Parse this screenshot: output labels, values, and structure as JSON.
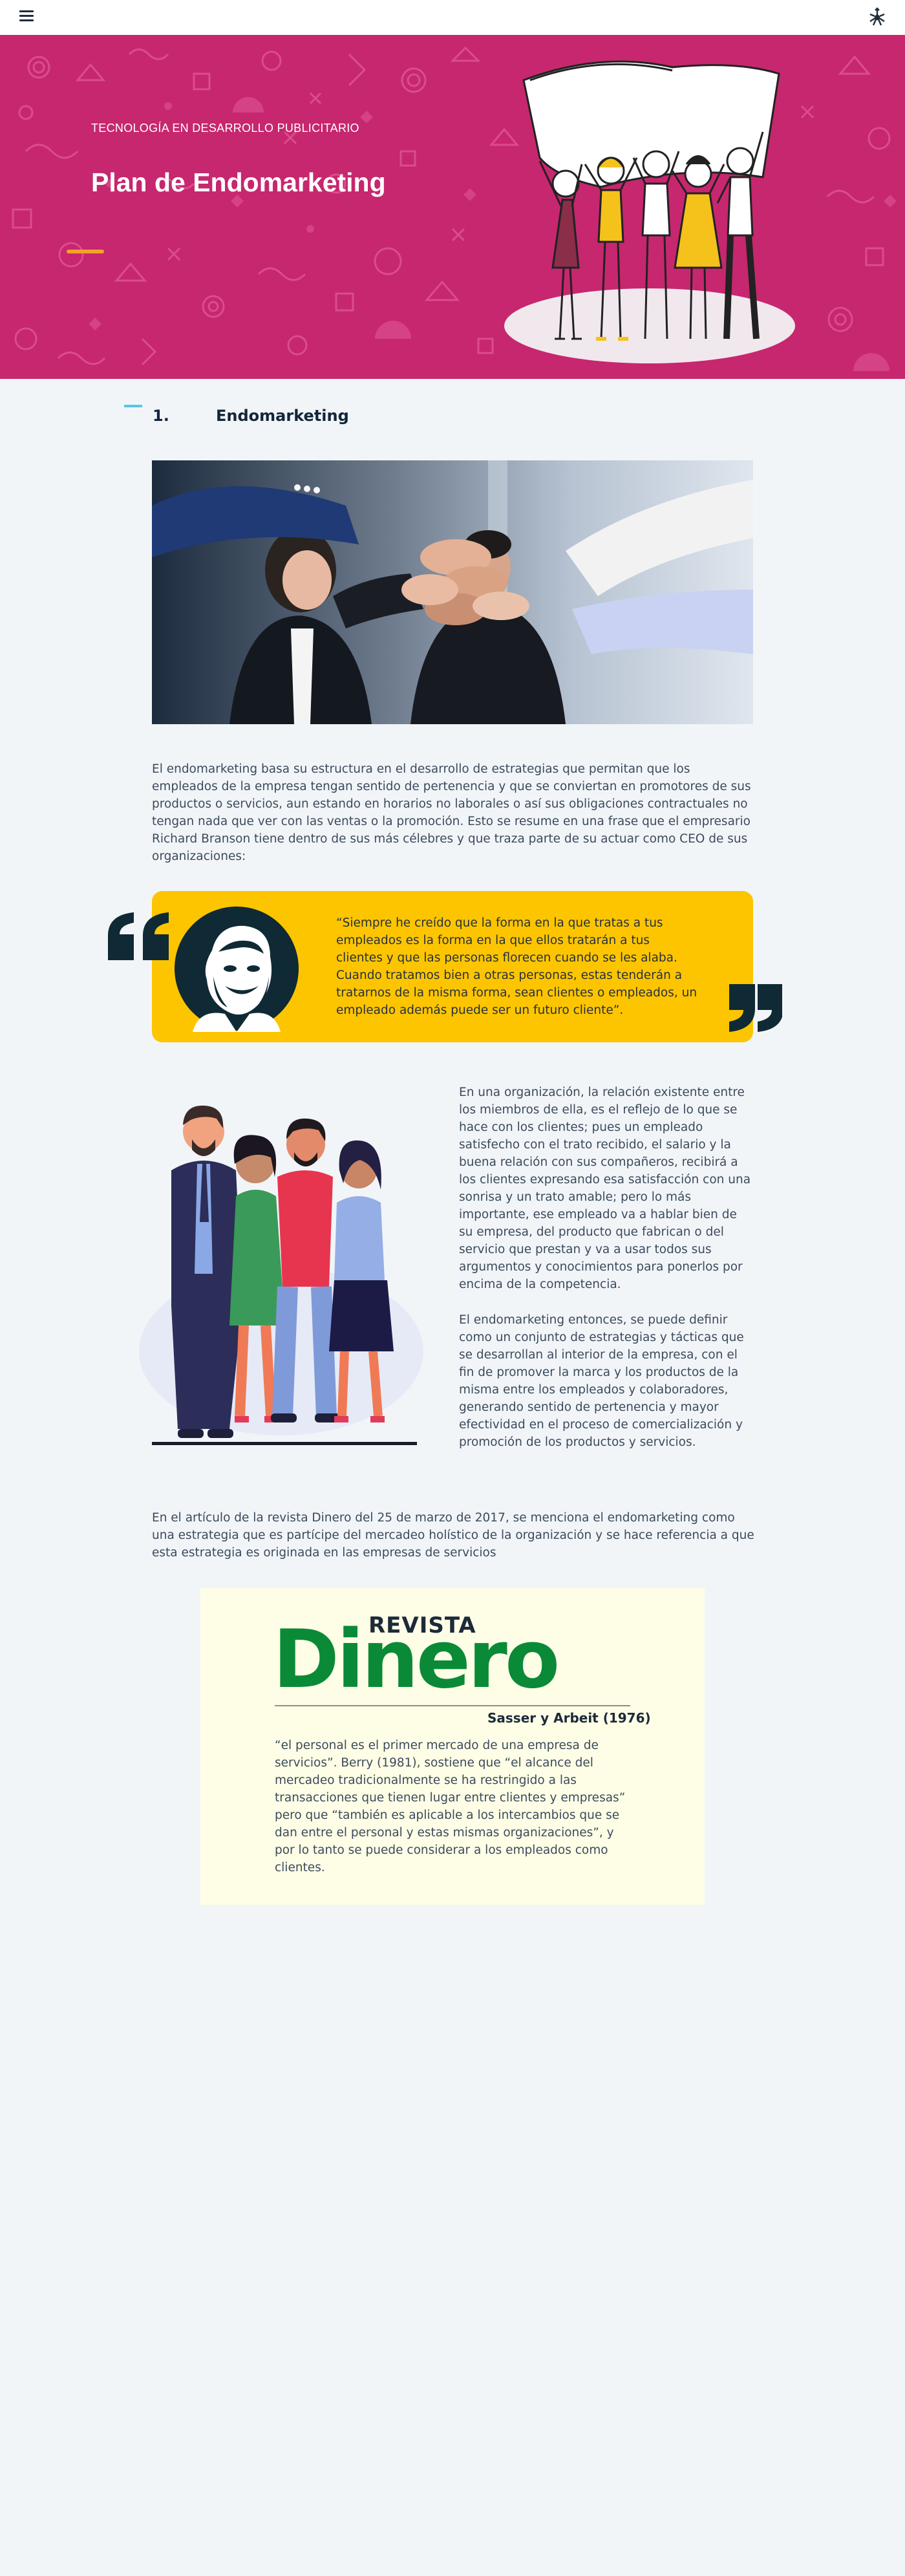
{
  "topbar": {
    "menu_icon": "hamburger-menu-icon",
    "logo_icon": "sena-logo-icon"
  },
  "hero": {
    "kicker": "TECNOLOGÍA EN DESARROLLO PUBLICITARIO",
    "title": "Plan de Endomarketing",
    "colors": {
      "background": "#c7276f",
      "accent": "#f2a12a"
    }
  },
  "section": {
    "number": "1.",
    "title": "Endomarketing"
  },
  "content": {
    "intro": "El endomarketing basa su estructura en el desarrollo de estrategias que permitan que los empleados de la empresa tengan sentido de pertenencia y que se conviertan en promotores de sus productos o servicios, aun estando en horarios no laborales o así sus obligaciones contractuales no tengan nada que ver con las ventas o la promoción. Esto se resume en una frase que el empresario Richard Branson tiene dentro de sus más célebres y que traza parte de su actuar como CEO de sus organizaciones:",
    "quote": "“Siempre he creído que la forma en la que tratas a tus empleados es la forma en la que ellos tratarán a tus clientes y que las personas florecen cuando se les alaba. Cuando tratamos bien a otras personas, estas tenderán a tratarnos de la misma forma, sean clientes o empleados, un empleado además puede ser un futuro cliente”.",
    "para2": "En una organización, la relación existente entre los miembros de ella, es el reflejo de lo que se hace con los clientes; pues un empleado satisfecho con el trato recibido, el salario y la buena relación con sus compañeros, recibirá a los clientes expresando esa satisfacción con una sonrisa y un trato amable; pero lo más importante, ese empleado va a hablar bien de su empresa, del producto que fabrican o del servicio que prestan y va a usar todos sus argumentos y conocimientos para ponerlos por encima de la competencia.",
    "para3": "El endomarketing entonces, se puede definir como un conjunto de estrategias y tácticas que se desarrollan al interior de la empresa, con el fin de promover la marca y los productos de la misma entre los empleados y colaboradores, generando sentido de pertenencia y mayor efectividad en el proceso de comercialización y promoción de los productos y servicios.",
    "para4": "En el artículo de la revista Dinero del 25 de marzo de 2017, se menciona el endomarketing como una estrategia que es partícipe del mercadeo holístico de la organización y se hace referencia a que esta estrategia es originada en las empresas de servicios"
  },
  "dinero": {
    "revista": "REVISTA",
    "logo": "Dinero",
    "author": "Sasser y Arbeit (1976)",
    "quote": "“el personal es el primer mercado de una empresa de servicios”. Berry (1981), sostiene que “el alcance del mercadeo tradicionalmente se ha restringido a las transacciones que tienen lugar entre clientes y empresas” pero que “también es aplicable a los intercambios que se dan entre el personal y estas mismas organizaciones”, y por lo tanto se puede considerar a los empleados como clientes.",
    "colors": {
      "card": "#fefee6",
      "logo": "#0a8a37"
    }
  },
  "quote_box": {
    "color": "#fdc500",
    "quote_mark_icon": "quote-mark-icon"
  }
}
